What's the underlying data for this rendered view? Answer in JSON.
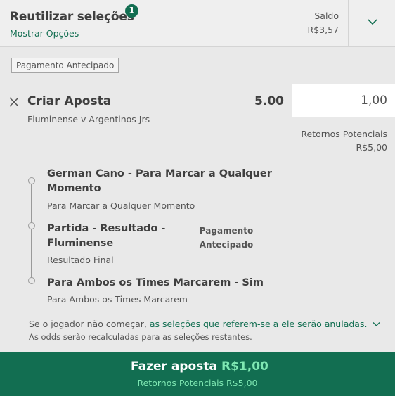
{
  "header": {
    "title": "Reutilizar seleções",
    "count": "1",
    "show_options": "Mostrar Opções",
    "balance_label": "Saldo",
    "balance_value": "R$3,57"
  },
  "tag": "Pagamento Antecipado",
  "bet": {
    "title": "Criar Aposta",
    "odds": "5.00",
    "stake": "1,00",
    "match": "Fluminense v Argentinos Jrs",
    "potential_returns_label": "Retornos Potenciais",
    "potential_returns_value": "R$5,00",
    "selections": [
      {
        "title_line1": "German Cano - Para Marcar a Qualquer",
        "title_line2": "Momento",
        "subtitle": "Para Marcar a Qualquer Momento"
      },
      {
        "title_line1": "Partida - Resultado -",
        "title_line2": "Fluminense",
        "subtitle": "Resultado Final",
        "badge_line1": "Pagamento",
        "badge_line2": "Antecipado"
      },
      {
        "title_line1": "Para Ambos os Times Marcarem - Sim",
        "subtitle": "Para Ambos os Times Marcarem"
      }
    ],
    "notice_prefix": "Se o jogador não começar, ",
    "notice_link": "as seleções que referem-se a ele serão anuladas.",
    "notice_line2": "As odds serão recalculadas para as seleções restantes."
  },
  "place_bet": {
    "label": "Fazer aposta",
    "amount": "R$1,00",
    "returns": "Retornos Potenciais R$5,00"
  },
  "colors": {
    "brand_green": "#126e51",
    "highlight_green": "#7fe8b3"
  },
  "icons": [
    "chevron-down-icon",
    "close-icon"
  ]
}
